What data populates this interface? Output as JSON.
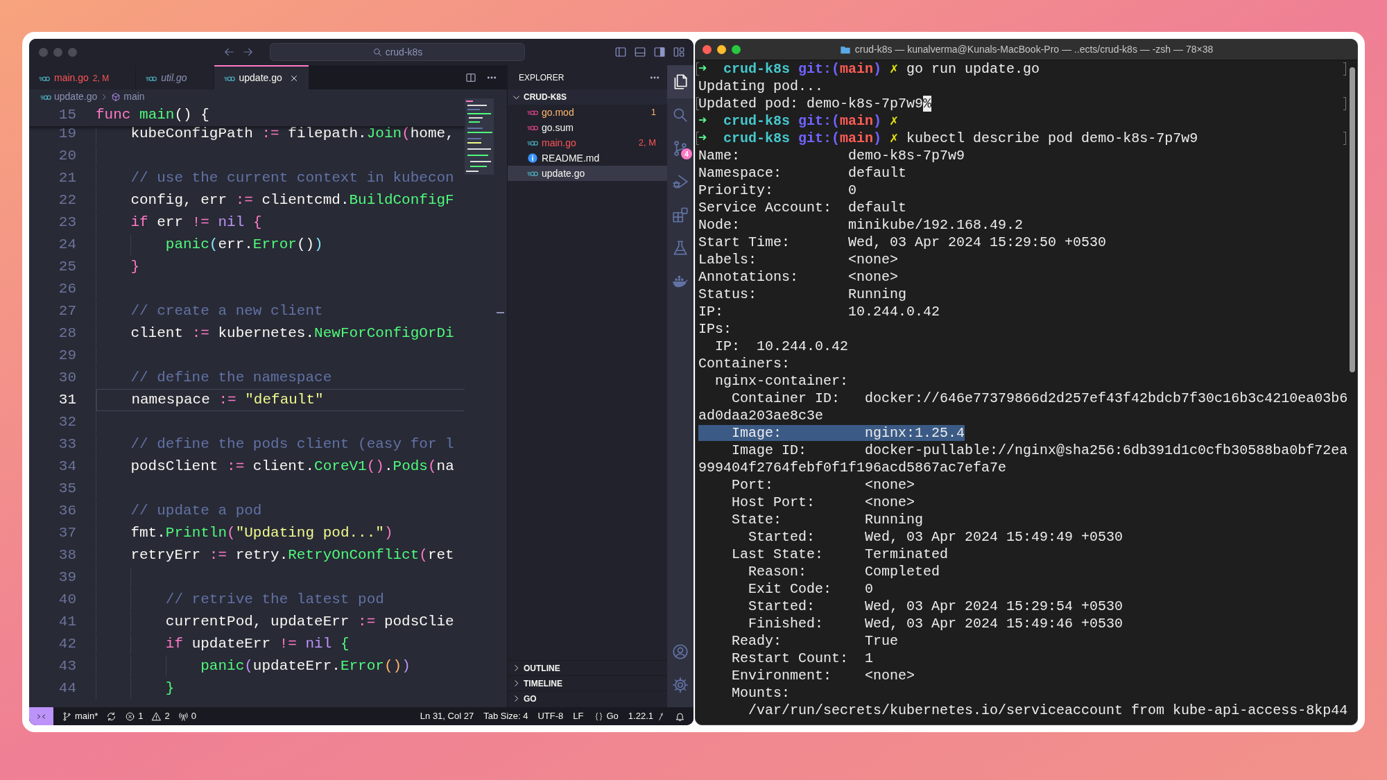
{
  "vscode": {
    "command_center": {
      "text": "crud-k8s"
    },
    "tabs": [
      {
        "label": "main.go",
        "badge": "2, M",
        "error": true,
        "preview": false,
        "selected": false
      },
      {
        "label": "util.go",
        "error": false,
        "preview": true,
        "selected": false
      },
      {
        "label": "update.go",
        "error": false,
        "preview": false,
        "selected": true
      }
    ],
    "breadcrumb": [
      {
        "label": "update.go",
        "kind": "file"
      },
      {
        "label": "main",
        "kind": "symbol"
      }
    ],
    "editor": {
      "sticky_line": {
        "number": "15",
        "tokens": [
          {
            "text": "func",
            "kind": "keyword"
          },
          {
            "text": " main",
            "kind": "function"
          },
          {
            "text": "() {",
            "kind": "plain"
          }
        ]
      },
      "lines": [
        {
          "number": "19",
          "current": false,
          "tokens": [
            {
              "text": "    kubeConfigPath ",
              "kind": "plain"
            },
            {
              "text": ":=",
              "kind": "operator"
            },
            {
              "text": " filepath.",
              "kind": "plain"
            },
            {
              "text": "Join",
              "kind": "function"
            },
            {
              "text": "(",
              "kind": "bracket1"
            },
            {
              "text": "home,",
              "kind": "plain"
            }
          ]
        },
        {
          "number": "20",
          "current": false
        },
        {
          "number": "21",
          "current": false,
          "tokens": [
            {
              "text": "    // use the current context in kubecon",
              "kind": "comment"
            }
          ]
        },
        {
          "number": "22",
          "current": false,
          "tokens": [
            {
              "text": "    config, err ",
              "kind": "plain"
            },
            {
              "text": ":=",
              "kind": "operator"
            },
            {
              "text": " clientcmd.",
              "kind": "plain"
            },
            {
              "text": "BuildConfigF",
              "kind": "function"
            }
          ]
        },
        {
          "number": "23",
          "current": false,
          "tokens": [
            {
              "text": "    if",
              "kind": "keyword"
            },
            {
              "text": " err ",
              "kind": "plain"
            },
            {
              "text": "!=",
              "kind": "operator"
            },
            {
              "text": " nil",
              "kind": "constant"
            },
            {
              "text": " {",
              "kind": "bracket1"
            }
          ]
        },
        {
          "number": "24",
          "current": false,
          "tokens": [
            {
              "text": "        panic",
              "kind": "function"
            },
            {
              "text": "(",
              "kind": "bracket2"
            },
            {
              "text": "err.",
              "kind": "plain"
            },
            {
              "text": "Error",
              "kind": "function"
            },
            {
              "text": "()",
              "kind": "plain"
            },
            {
              "text": ")",
              "kind": "bracket2"
            }
          ]
        },
        {
          "number": "25",
          "current": false,
          "tokens": [
            {
              "text": "    }",
              "kind": "bracket1"
            }
          ]
        },
        {
          "number": "26",
          "current": false
        },
        {
          "number": "27",
          "current": false,
          "tokens": [
            {
              "text": "    // create a new client",
              "kind": "comment"
            }
          ]
        },
        {
          "number": "28",
          "current": false,
          "tokens": [
            {
              "text": "    client ",
              "kind": "plain"
            },
            {
              "text": ":=",
              "kind": "operator"
            },
            {
              "text": " kubernetes.",
              "kind": "plain"
            },
            {
              "text": "NewForConfigOrDi",
              "kind": "function"
            }
          ]
        },
        {
          "number": "29",
          "current": false
        },
        {
          "number": "30",
          "current": false,
          "tokens": [
            {
              "text": "    // define the namespace",
              "kind": "comment"
            }
          ]
        },
        {
          "number": "31",
          "current": true,
          "tokens": [
            {
              "text": "    namespace ",
              "kind": "plain"
            },
            {
              "text": ":=",
              "kind": "operator"
            },
            {
              "text": " \"default\"",
              "kind": "string"
            }
          ]
        },
        {
          "number": "32",
          "current": false
        },
        {
          "number": "33",
          "current": false,
          "tokens": [
            {
              "text": "    // define the pods client (easy for l",
              "kind": "comment"
            }
          ]
        },
        {
          "number": "34",
          "current": false,
          "tokens": [
            {
              "text": "    podsClient ",
              "kind": "plain"
            },
            {
              "text": ":=",
              "kind": "operator"
            },
            {
              "text": " client.",
              "kind": "plain"
            },
            {
              "text": "CoreV1",
              "kind": "function"
            },
            {
              "text": "()",
              "kind": "bracket1"
            },
            {
              "text": ".",
              "kind": "plain"
            },
            {
              "text": "Pods",
              "kind": "function"
            },
            {
              "text": "(",
              "kind": "bracket1"
            },
            {
              "text": "na",
              "kind": "plain"
            }
          ]
        },
        {
          "number": "35",
          "current": false
        },
        {
          "number": "36",
          "current": false,
          "tokens": [
            {
              "text": "    // update a pod",
              "kind": "comment"
            }
          ]
        },
        {
          "number": "37",
          "current": false,
          "tokens": [
            {
              "text": "    fmt.",
              "kind": "plain"
            },
            {
              "text": "Println",
              "kind": "function"
            },
            {
              "text": "(",
              "kind": "bracket1"
            },
            {
              "text": "\"Updating pod...\"",
              "kind": "string"
            },
            {
              "text": ")",
              "kind": "bracket1"
            }
          ]
        },
        {
          "number": "38",
          "current": false,
          "tokens": [
            {
              "text": "    retryErr ",
              "kind": "plain"
            },
            {
              "text": ":=",
              "kind": "operator"
            },
            {
              "text": " retry.",
              "kind": "plain"
            },
            {
              "text": "RetryOnConflict",
              "kind": "function"
            },
            {
              "text": "(",
              "kind": "bracket1"
            },
            {
              "text": "ret",
              "kind": "plain"
            }
          ]
        },
        {
          "number": "39",
          "current": false
        },
        {
          "number": "40",
          "current": false,
          "tokens": [
            {
              "text": "        // retrive the latest pod",
              "kind": "comment"
            }
          ]
        },
        {
          "number": "41",
          "current": false,
          "tokens": [
            {
              "text": "        currentPod, updateErr ",
              "kind": "plain"
            },
            {
              "text": ":=",
              "kind": "operator"
            },
            {
              "text": " podsClie",
              "kind": "plain"
            }
          ]
        },
        {
          "number": "42",
          "current": false,
          "tokens": [
            {
              "text": "        if",
              "kind": "keyword"
            },
            {
              "text": " updateErr ",
              "kind": "plain"
            },
            {
              "text": "!=",
              "kind": "operator"
            },
            {
              "text": " nil",
              "kind": "constant"
            },
            {
              "text": " {",
              "kind": "bracket3"
            }
          ]
        },
        {
          "number": "43",
          "current": false,
          "tokens": [
            {
              "text": "            panic",
              "kind": "function"
            },
            {
              "text": "(",
              "kind": "bracket4"
            },
            {
              "text": "updateErr.",
              "kind": "plain"
            },
            {
              "text": "Error",
              "kind": "function"
            },
            {
              "text": "()",
              "kind": "bracket5"
            },
            {
              "text": ")",
              "kind": "bracket4"
            }
          ]
        },
        {
          "number": "44",
          "current": false,
          "tokens": [
            {
              "text": "        }",
              "kind": "bracket3"
            }
          ]
        }
      ]
    },
    "explorer": {
      "title": "EXPLORER",
      "folder": {
        "label": "CRUD-K8S",
        "expanded": true,
        "files": [
          {
            "label": "go.mod",
            "kind": "gomod",
            "warning": true,
            "error": false,
            "badge": "1",
            "selected": false
          },
          {
            "label": "go.sum",
            "kind": "gomod",
            "warning": false,
            "error": false,
            "selected": false
          },
          {
            "label": "main.go",
            "kind": "go",
            "warning": false,
            "error": true,
            "badge": "2, M",
            "selected": false
          },
          {
            "label": "README.md",
            "kind": "info",
            "warning": false,
            "error": false,
            "selected": false
          },
          {
            "label": "update.go",
            "kind": "go",
            "warning": false,
            "error": false,
            "selected": true
          }
        ]
      },
      "sections": [
        {
          "label": "OUTLINE",
          "expanded": false
        },
        {
          "label": "TIMELINE",
          "expanded": false
        },
        {
          "label": "GO",
          "expanded": false
        }
      ]
    },
    "activity_bar": {
      "top": [
        {
          "kind": "explorer",
          "selected": true
        },
        {
          "kind": "search",
          "selected": false
        },
        {
          "kind": "source-control",
          "selected": false,
          "badge": "4"
        },
        {
          "kind": "run-debug",
          "selected": false
        },
        {
          "kind": "extensions",
          "selected": false
        },
        {
          "kind": "testing",
          "selected": false
        },
        {
          "kind": "docker",
          "selected": false
        }
      ],
      "bottom": [
        {
          "kind": "accounts",
          "selected": false
        },
        {
          "kind": "settings",
          "selected": false
        }
      ]
    },
    "status_bar": {
      "left": [
        {
          "kind": "remote"
        },
        {
          "kind": "branch",
          "text": "main*"
        },
        {
          "kind": "sync"
        },
        {
          "kind": "errors",
          "text": "1"
        },
        {
          "kind": "warnings",
          "text": "2"
        },
        {
          "kind": "ports",
          "text": "0"
        }
      ],
      "right": [
        {
          "kind": "text",
          "text": "Ln 31, Col 27"
        },
        {
          "kind": "text",
          "text": "Tab Size: 4"
        },
        {
          "kind": "text",
          "text": "UTF-8"
        },
        {
          "kind": "text",
          "text": "LF"
        },
        {
          "kind": "language",
          "text": "Go"
        },
        {
          "kind": "version",
          "text": "1.22.1"
        },
        {
          "kind": "notifications"
        }
      ]
    }
  },
  "terminal": {
    "title": "crud-k8s — kunalverma@Kunals-MacBook-Pro — ..ects/crud-k8s — -zsh — 78×38",
    "lines": [
      {
        "marked": true,
        "tokens": [
          {
            "text": "➜",
            "kind": "arrow"
          },
          {
            "text": "  crud-k8s ",
            "kind": "dir"
          },
          {
            "text": "git:(",
            "kind": "git"
          },
          {
            "text": "main",
            "kind": "branch"
          },
          {
            "text": ") ",
            "kind": "git"
          },
          {
            "text": "✗",
            "kind": "dirty"
          },
          {
            "text": " go run update.go",
            "kind": "plain"
          }
        ]
      },
      {
        "marked": false,
        "tokens": [
          {
            "text": "Updating pod...",
            "kind": "plain"
          }
        ]
      },
      {
        "marked": true,
        "tokens": [
          {
            "text": "Updated pod: demo-k8s-7p7w9",
            "kind": "plain"
          },
          {
            "text": "%",
            "kind": "cursor"
          }
        ]
      },
      {
        "marked": false,
        "tokens": [
          {
            "text": "➜",
            "kind": "arrow"
          },
          {
            "text": "  crud-k8s ",
            "kind": "dir"
          },
          {
            "text": "git:(",
            "kind": "git"
          },
          {
            "text": "main",
            "kind": "branch"
          },
          {
            "text": ") ",
            "kind": "git"
          },
          {
            "text": "✗",
            "kind": "dirty"
          }
        ]
      },
      {
        "marked": true,
        "tokens": [
          {
            "text": "➜",
            "kind": "arrow"
          },
          {
            "text": "  crud-k8s ",
            "kind": "dir"
          },
          {
            "text": "git:(",
            "kind": "git"
          },
          {
            "text": "main",
            "kind": "branch"
          },
          {
            "text": ") ",
            "kind": "git"
          },
          {
            "text": "✗",
            "kind": "dirty"
          },
          {
            "text": " kubectl describe pod demo-k8s-7p7w9",
            "kind": "plain"
          }
        ]
      },
      {
        "marked": false,
        "tokens": [
          {
            "text": "Name:             demo-k8s-7p7w9",
            "kind": "plain"
          }
        ]
      },
      {
        "marked": false,
        "tokens": [
          {
            "text": "Namespace:        default",
            "kind": "plain"
          }
        ]
      },
      {
        "marked": false,
        "tokens": [
          {
            "text": "Priority:         0",
            "kind": "plain"
          }
        ]
      },
      {
        "marked": false,
        "tokens": [
          {
            "text": "Service Account:  default",
            "kind": "plain"
          }
        ]
      },
      {
        "marked": false,
        "tokens": [
          {
            "text": "Node:             minikube/192.168.49.2",
            "kind": "plain"
          }
        ]
      },
      {
        "marked": false,
        "tokens": [
          {
            "text": "Start Time:       Wed, 03 Apr 2024 15:29:50 +0530",
            "kind": "plain"
          }
        ]
      },
      {
        "marked": false,
        "tokens": [
          {
            "text": "Labels:           <none>",
            "kind": "plain"
          }
        ]
      },
      {
        "marked": false,
        "tokens": [
          {
            "text": "Annotations:      <none>",
            "kind": "plain"
          }
        ]
      },
      {
        "marked": false,
        "tokens": [
          {
            "text": "Status:           Running",
            "kind": "plain"
          }
        ]
      },
      {
        "marked": false,
        "tokens": [
          {
            "text": "IP:               10.244.0.42",
            "kind": "plain"
          }
        ]
      },
      {
        "marked": false,
        "tokens": [
          {
            "text": "IPs:",
            "kind": "plain"
          }
        ]
      },
      {
        "marked": false,
        "tokens": [
          {
            "text": "  IP:  10.244.0.42",
            "kind": "plain"
          }
        ]
      },
      {
        "marked": false,
        "tokens": [
          {
            "text": "Containers:",
            "kind": "plain"
          }
        ]
      },
      {
        "marked": false,
        "tokens": [
          {
            "text": "  nginx-container:",
            "kind": "plain"
          }
        ]
      },
      {
        "marked": false,
        "tokens": [
          {
            "text": "    Container ID:   docker://646e77379866d2d257ef43f42bdcb7f30c16b3c4210ea03b6",
            "kind": "plain"
          }
        ]
      },
      {
        "marked": false,
        "tokens": [
          {
            "text": "ad0daa203ae8c3e",
            "kind": "plain"
          }
        ]
      },
      {
        "marked": false,
        "tokens": [
          {
            "text": "    Image:          nginx:1.25.4",
            "kind": "selection"
          }
        ]
      },
      {
        "marked": false,
        "tokens": [
          {
            "text": "    Image ID:       docker-pullable://nginx@sha256:6db391d1c0cfb30588ba0bf72ea",
            "kind": "plain"
          }
        ]
      },
      {
        "marked": false,
        "tokens": [
          {
            "text": "999404f2764febf0f1f196acd5867ac7efa7e",
            "kind": "plain"
          }
        ]
      },
      {
        "marked": false,
        "tokens": [
          {
            "text": "    Port:           <none>",
            "kind": "plain"
          }
        ]
      },
      {
        "marked": false,
        "tokens": [
          {
            "text": "    Host Port:      <none>",
            "kind": "plain"
          }
        ]
      },
      {
        "marked": false,
        "tokens": [
          {
            "text": "    State:          Running",
            "kind": "plain"
          }
        ]
      },
      {
        "marked": false,
        "tokens": [
          {
            "text": "      Started:      Wed, 03 Apr 2024 15:49:49 +0530",
            "kind": "plain"
          }
        ]
      },
      {
        "marked": false,
        "tokens": [
          {
            "text": "    Last State:     Terminated",
            "kind": "plain"
          }
        ]
      },
      {
        "marked": false,
        "tokens": [
          {
            "text": "      Reason:       Completed",
            "kind": "plain"
          }
        ]
      },
      {
        "marked": false,
        "tokens": [
          {
            "text": "      Exit Code:    0",
            "kind": "plain"
          }
        ]
      },
      {
        "marked": false,
        "tokens": [
          {
            "text": "      Started:      Wed, 03 Apr 2024 15:29:54 +0530",
            "kind": "plain"
          }
        ]
      },
      {
        "marked": false,
        "tokens": [
          {
            "text": "      Finished:     Wed, 03 Apr 2024 15:49:46 +0530",
            "kind": "plain"
          }
        ]
      },
      {
        "marked": false,
        "tokens": [
          {
            "text": "    Ready:          True",
            "kind": "plain"
          }
        ]
      },
      {
        "marked": false,
        "tokens": [
          {
            "text": "    Restart Count:  1",
            "kind": "plain"
          }
        ]
      },
      {
        "marked": false,
        "tokens": [
          {
            "text": "    Environment:    <none>",
            "kind": "plain"
          }
        ]
      },
      {
        "marked": false,
        "tokens": [
          {
            "text": "    Mounts:",
            "kind": "plain"
          }
        ]
      },
      {
        "marked": false,
        "tokens": [
          {
            "text": "      /var/run/secrets/kubernetes.io/serviceaccount from kube-api-access-8kp44",
            "kind": "plain"
          }
        ]
      }
    ]
  }
}
